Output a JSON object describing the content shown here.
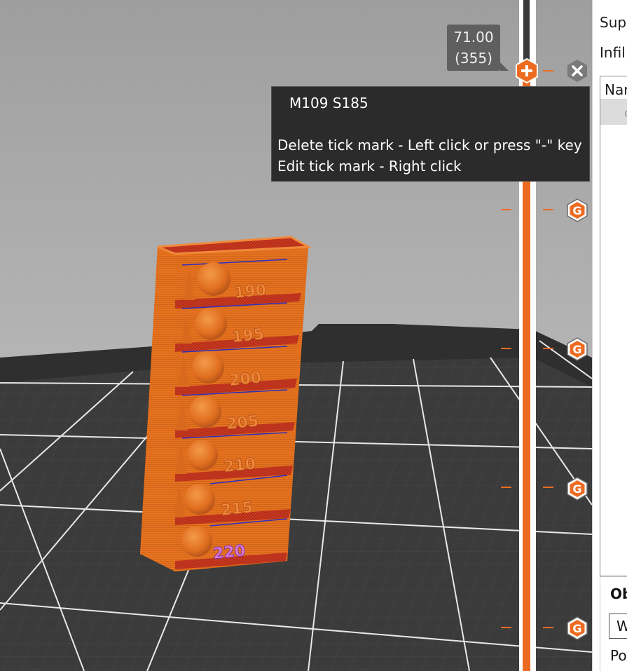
{
  "slider": {
    "height": "71.00",
    "layer": "(355)",
    "add_icon": "plus-icon",
    "delete_icon": "close-icon",
    "tick_icon": "gcode-icon",
    "tick_letter": "G"
  },
  "tooltip": {
    "gcode": "M109 S185",
    "delete_hint": "Delete tick mark - Left click or press \"-\" key",
    "edit_hint": "Edit tick mark - Right click"
  },
  "model": {
    "labels": [
      "190",
      "195",
      "200",
      "205",
      "210",
      "215",
      "220"
    ]
  },
  "right_panel": {
    "supports_label": "Sup",
    "infill_label": "Infil",
    "list_header": "Nar",
    "list_row": "c",
    "object_title": "Ob",
    "field_value": "W",
    "position_label": "Po"
  },
  "colors": {
    "accent": "#ed6b21",
    "model_body": "#e8731e",
    "model_top": "#c4361e",
    "wipe_blue": "#2a2dbf",
    "bed": "#3b3b3b",
    "background": "#a9a9a9"
  }
}
